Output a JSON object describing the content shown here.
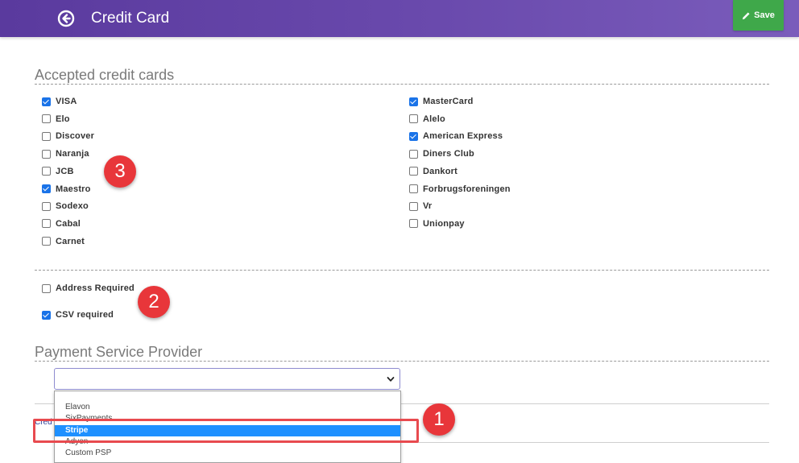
{
  "header": {
    "title": "Credit Card",
    "save_label": "Save",
    "bg_color": "#6a4aad",
    "save_color": "#3fa84a"
  },
  "accepted_cards": {
    "title": "Accepted credit cards",
    "left": [
      {
        "label": "VISA",
        "checked": true
      },
      {
        "label": "Elo",
        "checked": false
      },
      {
        "label": "Discover",
        "checked": false
      },
      {
        "label": "Naranja",
        "checked": false
      },
      {
        "label": "JCB",
        "checked": false
      },
      {
        "label": "Maestro",
        "checked": true
      },
      {
        "label": "Sodexo",
        "checked": false
      },
      {
        "label": "Cabal",
        "checked": false
      },
      {
        "label": "Carnet",
        "checked": false
      }
    ],
    "right": [
      {
        "label": "MasterCard",
        "checked": true
      },
      {
        "label": "Alelo",
        "checked": false
      },
      {
        "label": "American Express",
        "checked": true
      },
      {
        "label": "Diners Club",
        "checked": false
      },
      {
        "label": "Dankort",
        "checked": false
      },
      {
        "label": "Forbrugsforeningen",
        "checked": false
      },
      {
        "label": "Vr",
        "checked": false
      },
      {
        "label": "Unionpay",
        "checked": false
      }
    ]
  },
  "options": {
    "address_required": {
      "label": "Address Required",
      "checked": false
    },
    "csv_required": {
      "label": "CSV required",
      "checked": true
    }
  },
  "psp": {
    "title": "Payment Service Provider",
    "selected_value": "",
    "dropdown_options": [
      "Elavon",
      "SixPayments",
      "Stripe",
      "Adyen",
      "Custom PSP"
    ],
    "highlighted_option": "Stripe"
  },
  "credit_link": "Cred",
  "annotations": {
    "marker_1": "1",
    "marker_2": "2",
    "marker_3": "3",
    "marker_color": "#e8363a"
  }
}
